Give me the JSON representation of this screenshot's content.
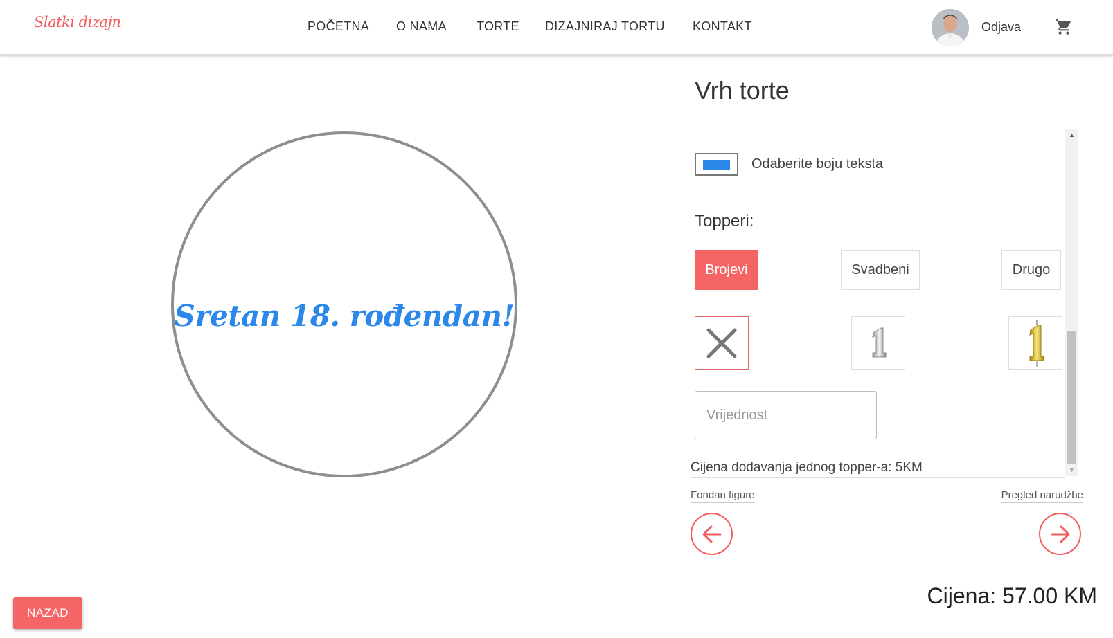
{
  "header": {
    "logo": "Slatki dizajn",
    "nav": [
      {
        "label": "POČETNA"
      },
      {
        "label": "O NAMA"
      },
      {
        "label": "TORTE"
      },
      {
        "label": "DIZAJNIRAJ TORTU"
      },
      {
        "label": "KONTAKT"
      }
    ],
    "logout_label": "Odjava",
    "avatar_icon": "user-avatar",
    "cart_icon": "shopping-cart-icon"
  },
  "preview": {
    "cake_text": "Sretan 18. rođendan!",
    "text_color": "#2b87e8",
    "border_color": "#8e8e8e"
  },
  "panel": {
    "title": "Vrh torte",
    "text_color_label": "Odaberite boju teksta",
    "selected_text_color": "#2b87e8",
    "toppers_label": "Topperi:",
    "tabs": [
      {
        "label": "Brojevi",
        "active": true
      },
      {
        "label": "Svadbeni",
        "active": false
      },
      {
        "label": "Drugo",
        "active": false
      }
    ],
    "topper_options": [
      {
        "icon": "close-icon",
        "selected": true
      },
      {
        "icon": "silver-number-1-topper",
        "selected": false
      },
      {
        "icon": "gold-number-1-candle",
        "selected": false
      }
    ],
    "value_placeholder": "Vrijednost",
    "value": "",
    "price_note": "Cijena dodavanja jednog topper-a: 5KM",
    "prev_step_label": "Fondan figure",
    "next_step_label": "Pregled narudžbe",
    "prev_icon": "arrow-left-icon",
    "next_icon": "arrow-right-icon",
    "accent_color": "#f25c5c"
  },
  "footer": {
    "total_price": "Cijena: 57.00 KM",
    "back_label": "NAZAD"
  }
}
